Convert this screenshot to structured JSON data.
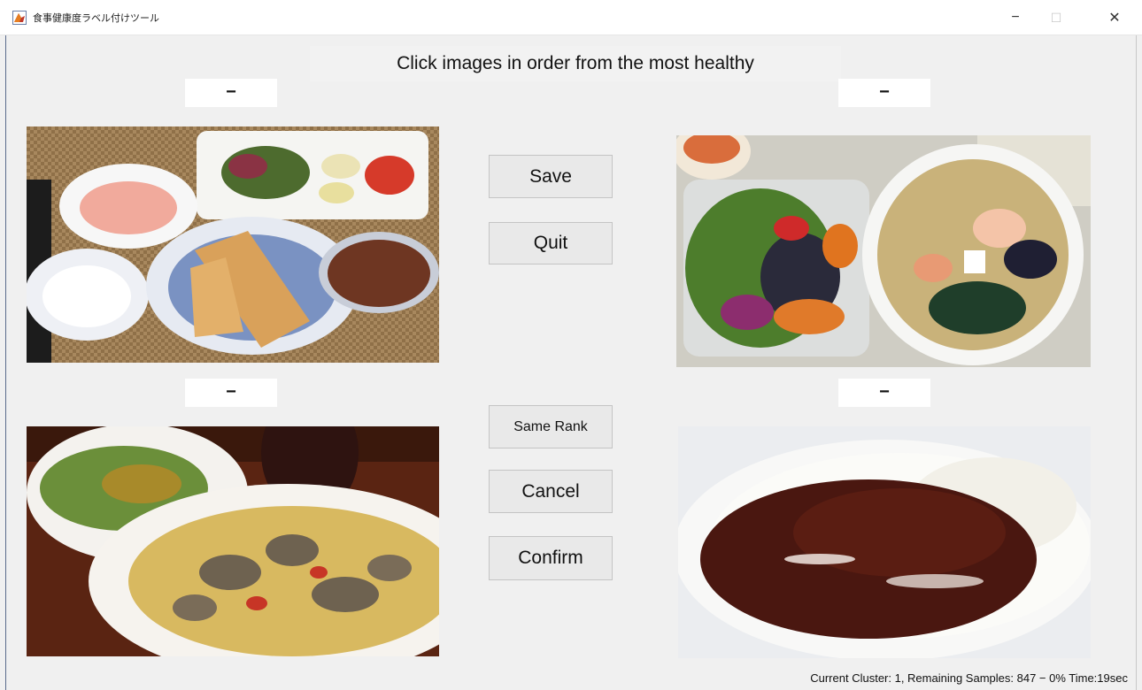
{
  "window": {
    "title": "食事健康度ラベル付けツール",
    "controls": {
      "minimize": "−",
      "maximize": "☐",
      "close": "✕"
    }
  },
  "instruction": "Click images in order from the most healthy",
  "images": [
    {
      "rank_label": "−",
      "depicts": "toast breakfast with salad, yogurt, fruit and soup"
    },
    {
      "rank_label": "−",
      "depicts": "convenience-store vegetable salad with noodle soup"
    },
    {
      "rank_label": "−",
      "depicts": "spaghetti with clams and side salad"
    },
    {
      "rank_label": "−",
      "depicts": "curry rice"
    }
  ],
  "buttons": {
    "save": "Save",
    "quit": "Quit",
    "same_rank": "Same Rank",
    "cancel": "Cancel",
    "confirm": "Confirm"
  },
  "status": "Current Cluster: 1, Remaining Samples: 847 − 0%  Time:19sec",
  "colors": {
    "window_bg": "#f0f0f0",
    "button_bg": "#e9e9e9",
    "label_bg": "#ffffff"
  }
}
